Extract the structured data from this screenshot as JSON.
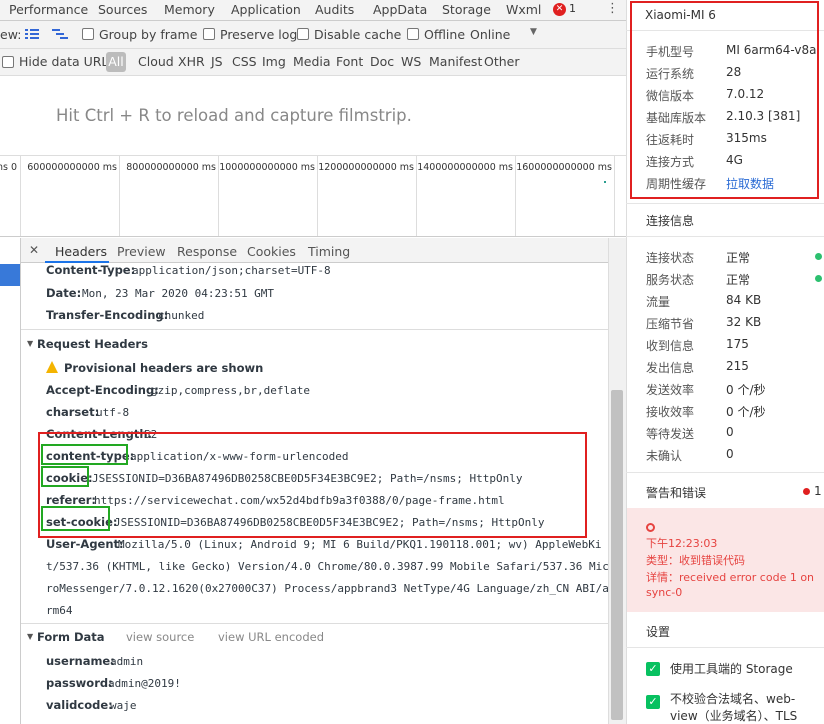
{
  "tabbar": {
    "tabs": [
      "Performance",
      "Sources",
      "Memory",
      "Application",
      "Audits",
      "AppData",
      "Storage",
      "Wxml"
    ],
    "error_count": "1"
  },
  "toolbar2": {
    "view_label": "ew:",
    "group_by_frame": "Group by frame",
    "preserve_log": "Preserve log",
    "disable_cache": "Disable cache",
    "offline": "Offline",
    "throttle_value": "Online"
  },
  "toolbar3": {
    "hide_data_urls": "Hide data URLs",
    "filters": [
      "All",
      "Cloud",
      "XHR",
      "JS",
      "CSS",
      "Img",
      "Media",
      "Font",
      "Doc",
      "WS",
      "Manifest",
      "Other"
    ]
  },
  "filmstrip": {
    "hint": "Hit Ctrl + R to reload and capture filmstrip."
  },
  "timeline": {
    "ticks": [
      "0 ms",
      "600000000000 ms",
      "800000000000 ms",
      "1000000000000 ms",
      "1200000000000 ms",
      "1400000000000 ms",
      "1600000000000 ms"
    ]
  },
  "detail": {
    "tabs": [
      "Headers",
      "Preview",
      "Response",
      "Cookies",
      "Timing"
    ],
    "response_headers": [
      {
        "key": "Content-Type:",
        "value": "application/json;charset=UTF-8"
      },
      {
        "key": "Date:",
        "value": "Mon, 23 Mar 2020 04:23:51 GMT"
      },
      {
        "key": "Transfer-Encoding:",
        "value": "chunked"
      }
    ],
    "request_section": "Request Headers",
    "provisional": "Provisional headers are shown",
    "request_headers": [
      {
        "key": "Accept-Encoding:",
        "value": "gzip,compress,br,deflate"
      },
      {
        "key": "charset:",
        "value": "utf-8"
      },
      {
        "key": "Content-Length:",
        "value": "52"
      },
      {
        "key": "content-type:",
        "value": "application/x-www-form-urlencoded"
      },
      {
        "key": "cookie:",
        "value": "JSESSIONID=D36BA87496DB0258CBE0D5F34E3BC9E2; Path=/nsms; HttpOnly"
      },
      {
        "key": "referer:",
        "value": "https://servicewechat.com/wx52d4bdfb9a3f0388/0/page-frame.html"
      },
      {
        "key": "set-cookie:",
        "value": "JSESSIONID=D36BA87496DB0258CBE0D5F34E3BC9E2; Path=/nsms; HttpOnly"
      },
      {
        "key": "User-Agent:",
        "value": "Mozilla/5.0 (Linux; Android 9; MI 6 Build/PKQ1.190118.001; wv) AppleWebKi"
      }
    ],
    "ua_continued": [
      "t/537.36 (KHTML, like Gecko) Version/4.0 Chrome/80.0.3987.99 Mobile Safari/537.36 Mic",
      "roMessenger/7.0.12.1620(0x27000C37) Process/appbrand3 NetType/4G Language/zh_CN ABI/a",
      "rm64"
    ],
    "form_section": "Form Data",
    "view_source": "view source",
    "view_url_encoded": "view URL encoded",
    "form_data": [
      {
        "key": "username:",
        "value": "admin"
      },
      {
        "key": "password:",
        "value": "admin@2019!"
      },
      {
        "key": "validcode:",
        "value": "waje"
      }
    ]
  },
  "rpanel": {
    "device": "Xiaomi-MI 6",
    "device_info": [
      {
        "key": "手机型号",
        "value": "MI 6arm64-v8a"
      },
      {
        "key": "运行系统",
        "value": "28"
      },
      {
        "key": "微信版本",
        "value": "7.0.12"
      },
      {
        "key": "基础库版本",
        "value": "2.10.3 [381]"
      },
      {
        "key": "往返耗时",
        "value": "315ms"
      },
      {
        "key": "连接方式",
        "value": "4G"
      },
      {
        "key": "周期性缓存",
        "value": "拉取数据"
      }
    ],
    "conn_title": "连接信息",
    "conn_info": [
      {
        "key": "连接状态",
        "value": "正常"
      },
      {
        "key": "服务状态",
        "value": "正常"
      },
      {
        "key": "流量",
        "value": "84 KB"
      },
      {
        "key": "压缩节省",
        "value": "32 KB"
      },
      {
        "key": "收到信息",
        "value": "175"
      },
      {
        "key": "发出信息",
        "value": "215"
      },
      {
        "key": "发送效率",
        "value": "0 个/秒"
      },
      {
        "key": "接收效率",
        "value": "0 个/秒"
      },
      {
        "key": "等待发送",
        "value": "0"
      },
      {
        "key": "未确认",
        "value": "0"
      }
    ],
    "warn_title": "警告和错误",
    "warn_count": "1",
    "error": {
      "time": "下午12:23:03",
      "type": "类型：收到错误代码",
      "detail": "详情：received error code 1 on",
      "detail2": "sync-0"
    },
    "settings_title": "设置",
    "settings": [
      "使用工具端的 Storage",
      "不校验合法域名、web-",
      "view（业务域名）、TLS"
    ]
  },
  "colors": {
    "accent": "#1a73e8",
    "red_box": "#e02020",
    "green_box": "#22a822",
    "ok_dot": "#2cc06f",
    "error_bg": "#fbe6e6",
    "error_text": "#e64340",
    "link": "#2a6bd4"
  }
}
